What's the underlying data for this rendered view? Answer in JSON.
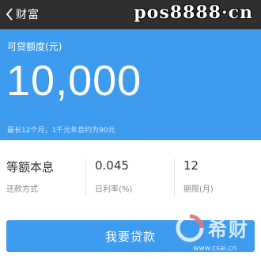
{
  "topbar": {
    "back_label": "财富",
    "watermark": "pos8888·cn"
  },
  "loan": {
    "label": "可贷额度(元)",
    "amount": "10,000",
    "note": "最长12个月，1千元年息约为90元"
  },
  "stats": [
    {
      "value": "等额本息",
      "caption": "还款方式"
    },
    {
      "value": "0.045",
      "caption": "日利率(%)"
    },
    {
      "value": "12",
      "caption": "期限(月)"
    }
  ],
  "apply": {
    "label": "我要贷款"
  },
  "watermark_bottom": {
    "brand": "希财",
    "url": "www.csai.cn"
  },
  "colors": {
    "accent": "#3d9bf0",
    "topbar": "#2f2f2f"
  }
}
